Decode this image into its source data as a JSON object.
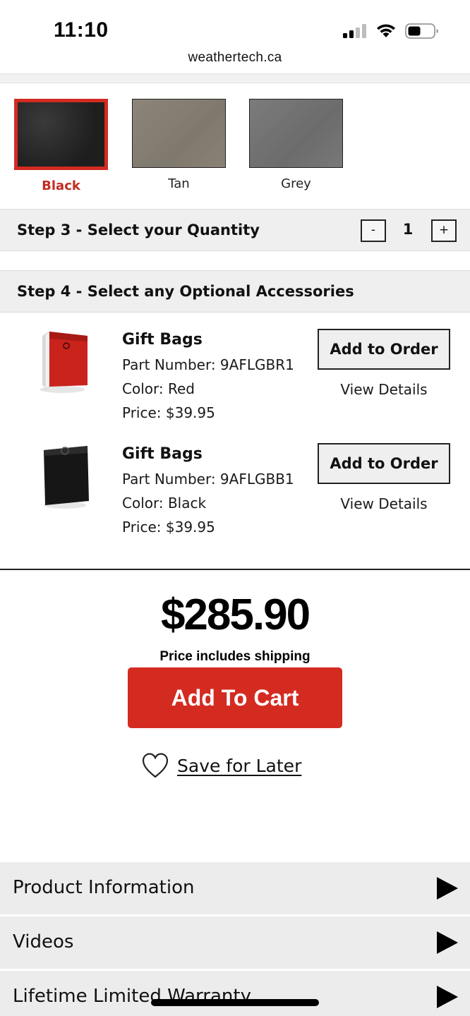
{
  "status_bar": {
    "time": "11:10",
    "url": "weathertech.ca"
  },
  "colors": {
    "accent": "#d42b21",
    "selected_label": "#c32c22",
    "step_bar_bg": "#efefef",
    "accordion_bg": "#ececec"
  },
  "swatches": [
    {
      "label": "Black",
      "selected": true,
      "color": "#2a2a2a"
    },
    {
      "label": "Tan",
      "selected": false,
      "color": "#867f74"
    },
    {
      "label": "Grey",
      "selected": false,
      "color": "#737373"
    }
  ],
  "step3": {
    "title": "Step 3 - Select your Quantity",
    "minus": "-",
    "quantity": "1",
    "plus": "+"
  },
  "step4": {
    "title": "Step 4 - Select any Optional Accessories"
  },
  "accessories": [
    {
      "title": "Gift Bags",
      "part": "Part Number: 9AFLGBR1",
      "color": "Color: Red",
      "price": "Price: $39.95",
      "add_label": "Add to Order",
      "details_label": "View Details",
      "image_icon": "red-gift-bag-icon"
    },
    {
      "title": "Gift Bags",
      "part": "Part Number: 9AFLGBB1",
      "color": "Color: Black",
      "price": "Price: $39.95",
      "add_label": "Add to Order",
      "details_label": "View Details",
      "image_icon": "black-gift-bag-icon"
    }
  ],
  "summary": {
    "total": "$285.90",
    "shipping_note": "Price includes shipping",
    "add_to_cart": "Add To Cart",
    "save_for_later": "Save for Later"
  },
  "accordion": [
    {
      "label": "Product Information"
    },
    {
      "label": "Videos"
    },
    {
      "label": "Lifetime Limited Warranty"
    }
  ]
}
